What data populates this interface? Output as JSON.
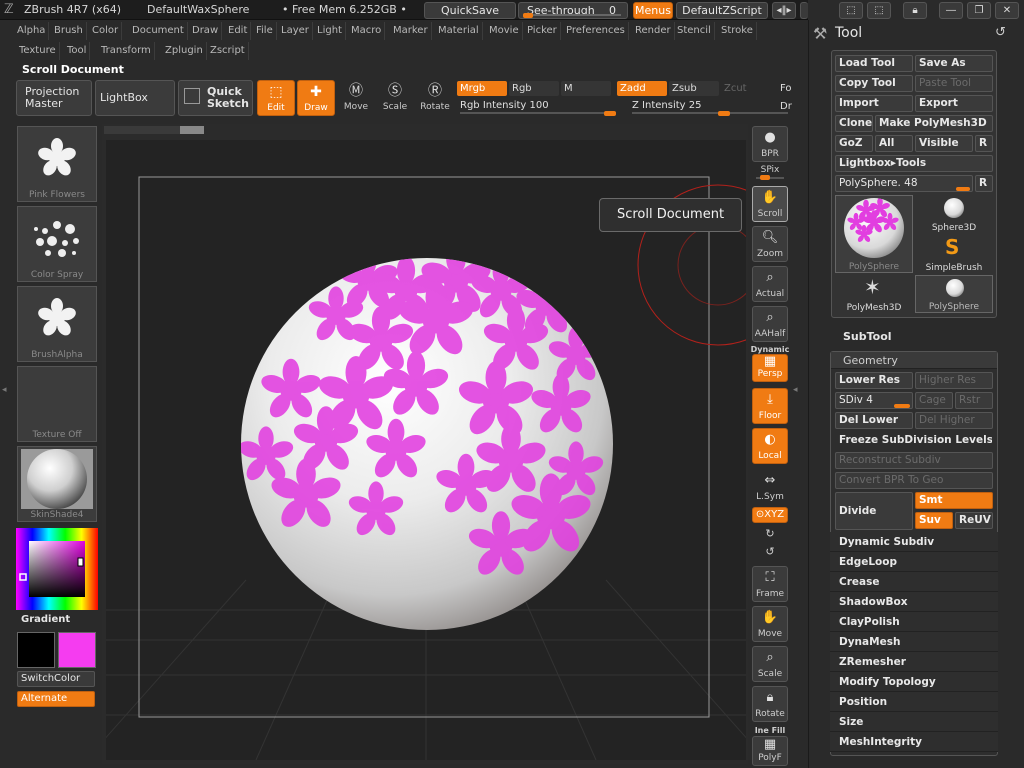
{
  "titlebar": {
    "app": "ZBrush 4R7 (x64)",
    "document": "DefaultWaxSphere",
    "memory": "• Free Mem 6.252GB •",
    "quicksave": "QuickSave",
    "seethrough": "See-through",
    "seethrough_value": "0",
    "menus": "Menus",
    "zscript": "DefaultZScript"
  },
  "menubar": {
    "row1": [
      "Alpha",
      "Brush",
      "Color",
      "Document",
      "Draw",
      "Edit",
      "File",
      "Layer",
      "Light",
      "Macro",
      "Marker",
      "Material",
      "Movie",
      "Picker",
      "Preferences",
      "Render",
      "Stencil",
      "Stroke"
    ],
    "row2": [
      "Texture",
      "Tool",
      "Transform",
      "Zplugin",
      "Zscript"
    ]
  },
  "status_label": "Scroll Document",
  "shelf": {
    "projection_master": [
      "Projection",
      "Master"
    ],
    "lightbox": "LightBox",
    "quick_sketch": [
      "Quick",
      "Sketch"
    ],
    "edit": "Edit",
    "draw": "Draw",
    "move": "Move",
    "scale": "Scale",
    "rotate": "Rotate",
    "mrgb": "Mrgb",
    "rgb": "Rgb",
    "m": "M",
    "zadd": "Zadd",
    "zsub": "Zsub",
    "zcut": "Zcut",
    "fo": "Fo",
    "dr": "Dr",
    "rgb_intensity_label": "Rgb Intensity",
    "rgb_intensity": 100,
    "z_intensity_label": "Z Intensity",
    "z_intensity": 25
  },
  "lefttray": {
    "brush_alpha_1": "Pink Flowers",
    "stroke": "Color Spray",
    "alpha": "BrushAlpha",
    "texture": "Texture Off",
    "material": "SkinShade4",
    "gradient": "Gradient",
    "switchcolor": "SwitchColor",
    "alternate": "Alternate",
    "main_color": "#000000",
    "secondary_color": "#f53cf0"
  },
  "vbar": {
    "bpr": "BPR",
    "spix": "SPix",
    "scroll": "Scroll",
    "zoom": "Zoom",
    "actual": "Actual",
    "aahalf": "AAHalf",
    "dynamic": "Dynamic",
    "persp": "Persp",
    "floor": "Floor",
    "local": "Local",
    "lsym": "L.Sym",
    "xyz": "⊙XYZ",
    "frame": "Frame",
    "move": "Move",
    "scale": "Scale",
    "rotate": "Rotate",
    "linefill": "Ine Fill",
    "polyf": "PolyF"
  },
  "tooltip": "Scroll Document",
  "toolpanel": {
    "title": "Tool",
    "load_tool": "Load Tool",
    "save_as": "Save As",
    "copy_tool": "Copy Tool",
    "paste_tool": "Paste Tool",
    "import": "Import",
    "export": "Export",
    "clone": "Clone",
    "make_polymesh": "Make PolyMesh3D",
    "goz": "GoZ",
    "all": "All",
    "visible": "Visible",
    "r": "R",
    "lightbox_tools": "Lightbox▸Tools",
    "polysphere_label": "PolySphere. 48",
    "tools": [
      "PolySphere",
      "Sphere3D",
      "SimpleBrush",
      "PolyMesh3D",
      "PolySphere"
    ]
  },
  "subtool": {
    "title": "SubTool",
    "geometry": "Geometry",
    "lower_res": "Lower Res",
    "higher_res": "Higher Res",
    "sdiv_label": "SDiv 4",
    "cage": "Cage",
    "rstr": "Rstr",
    "del_lower": "Del Lower",
    "del_higher": "Del Higher",
    "freeze": "Freeze SubDivision Levels",
    "reconstruct": "Reconstruct Subdiv",
    "convert_bpr": "Convert BPR To Geo",
    "divide": "Divide",
    "smt": "Smt",
    "suv": "Suv",
    "reuv": "ReUV",
    "sections": [
      "Dynamic Subdiv",
      "EdgeLoop",
      "Crease",
      "ShadowBox",
      "ClayPolish",
      "DynaMesh",
      "ZRemesher",
      "Modify Topology",
      "Position",
      "Size",
      "MeshIntegrity"
    ]
  },
  "colors": {
    "accent": "#f07b13",
    "paint": "#e23ee0"
  }
}
